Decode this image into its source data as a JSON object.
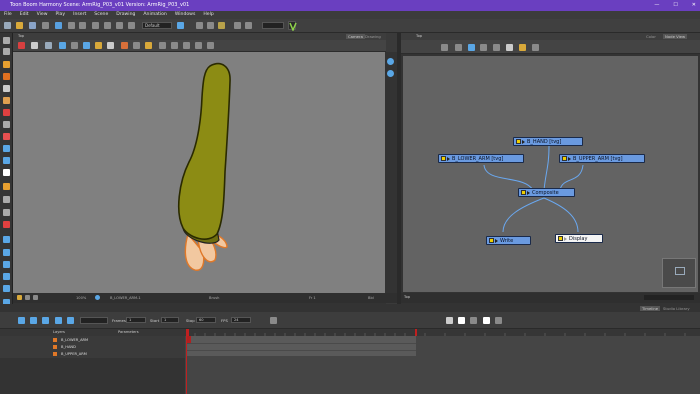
{
  "window": {
    "title": "Toon Boom Harmony Scene: ArmRig_P03_v01 Version: ArmRig_P03_v01",
    "controls": [
      "—",
      "☐",
      "✕"
    ]
  },
  "menu": [
    "File",
    "Edit",
    "View",
    "Play",
    "Insert",
    "Scene",
    "Drawing",
    "Animation",
    "Windows",
    "Help"
  ],
  "toolbar": {
    "workspace_select": "Default"
  },
  "camera_view": {
    "tabs": [
      "Camera",
      "Drawing"
    ],
    "top_label": "Top",
    "status": {
      "zoom": "100%",
      "drawing": "B_LOWER_ARM-1",
      "mode": "Brush",
      "frame": "Fr 1",
      "zoom_right": "Bbl"
    }
  },
  "node_view": {
    "tabs": [
      "Color",
      "Node View"
    ],
    "top_label": "Top",
    "footer_label": "Top",
    "nodes": {
      "b_hand": "B_HAND  [tvg]",
      "b_lower_arm": "B_LOWER_ARM  [tvg]",
      "b_upper_arm": "B_UPPER_ARM  [tvg]",
      "composite": "Composite",
      "write": "Write",
      "display": "Display"
    }
  },
  "timeline": {
    "tabs": [
      "Timeline",
      "Xsheet",
      "Studio Library"
    ],
    "fields": {
      "frames_label": "Frames",
      "frames_value": "1",
      "start_label": "Start",
      "start_value": "1",
      "stop_label": "Stop",
      "stop_value": "60",
      "fps_label": "FPS",
      "fps_value": "24"
    },
    "columns": {
      "layers": "Layers",
      "parameters": "Parameters"
    },
    "layers": [
      "B_LOWER_ARM",
      "B_HAND",
      "B_UPPER_ARM"
    ]
  },
  "colors": {
    "title_bar": "#6a3fc0",
    "node_blue": "#6a9ae0",
    "arm_fill": "#8c8c14",
    "hand_fill": "#f2c8a0",
    "playhead": "#c02020"
  }
}
